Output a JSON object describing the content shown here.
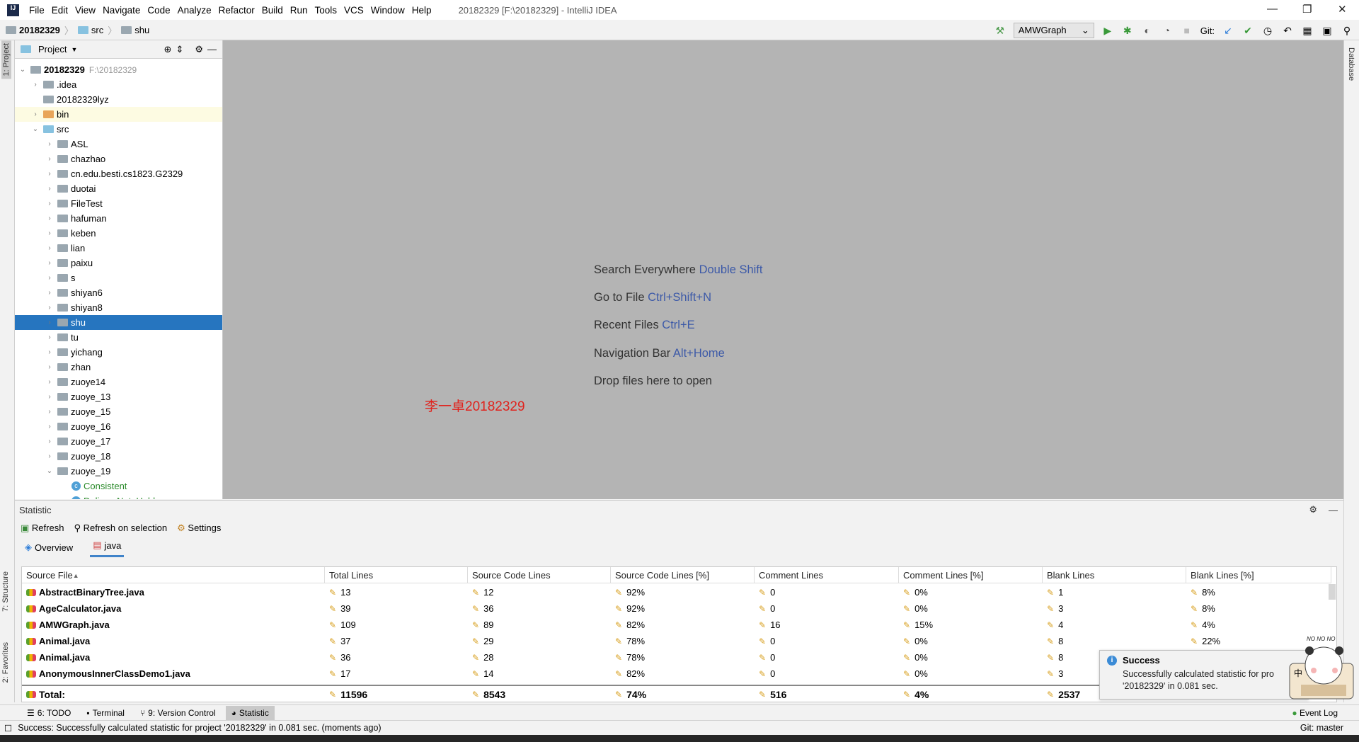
{
  "app": {
    "title": "20182329 [F:\\20182329] - IntelliJ IDEA",
    "logo": "IJ"
  },
  "menu": [
    "File",
    "Edit",
    "View",
    "Navigate",
    "Code",
    "Analyze",
    "Refactor",
    "Build",
    "Run",
    "Tools",
    "VCS",
    "Window",
    "Help"
  ],
  "breadcrumb": [
    "20182329",
    "src",
    "shu"
  ],
  "toolbar": {
    "run_config": "AMWGraph",
    "git_label": "Git:",
    "git_branch": "Git: master"
  },
  "left_stripe": {
    "project": "1: Project",
    "structure": "7: Structure",
    "favorites": "2: Favorites"
  },
  "right_stripe": {
    "database": "Database"
  },
  "project_panel": {
    "title": "Project",
    "tree": [
      {
        "level": 0,
        "name": "20182329",
        "note": "F:\\20182329",
        "type": "root",
        "arrow": "down"
      },
      {
        "level": 1,
        "name": ".idea",
        "type": "folder",
        "arrow": "right"
      },
      {
        "level": 1,
        "name": "20182329lyz",
        "type": "folder",
        "arrow": ""
      },
      {
        "level": 1,
        "name": "bin",
        "type": "folder-orange",
        "arrow": "right",
        "highlight": true
      },
      {
        "level": 1,
        "name": "src",
        "type": "folder-blue",
        "arrow": "down"
      },
      {
        "level": 2,
        "name": "ASL",
        "type": "package",
        "arrow": "right"
      },
      {
        "level": 2,
        "name": "chazhao",
        "type": "package",
        "arrow": "right"
      },
      {
        "level": 2,
        "name": "cn.edu.besti.cs1823.G2329",
        "type": "package",
        "arrow": "right"
      },
      {
        "level": 2,
        "name": "duotai",
        "type": "package",
        "arrow": "right"
      },
      {
        "level": 2,
        "name": "FileTest",
        "type": "package",
        "arrow": "right"
      },
      {
        "level": 2,
        "name": "hafuman",
        "type": "package",
        "arrow": "right"
      },
      {
        "level": 2,
        "name": "keben",
        "type": "package",
        "arrow": "right"
      },
      {
        "level": 2,
        "name": "lian",
        "type": "package",
        "arrow": "right"
      },
      {
        "level": 2,
        "name": "paixu",
        "type": "package",
        "arrow": "right"
      },
      {
        "level": 2,
        "name": "s",
        "type": "package",
        "arrow": "right"
      },
      {
        "level": 2,
        "name": "shiyan6",
        "type": "package",
        "arrow": "right"
      },
      {
        "level": 2,
        "name": "shiyan8",
        "type": "package",
        "arrow": "right"
      },
      {
        "level": 2,
        "name": "shu",
        "type": "package",
        "arrow": "right",
        "selected": true
      },
      {
        "level": 2,
        "name": "tu",
        "type": "package",
        "arrow": "right"
      },
      {
        "level": 2,
        "name": "yichang",
        "type": "package",
        "arrow": "right"
      },
      {
        "level": 2,
        "name": "zhan",
        "type": "package",
        "arrow": "right"
      },
      {
        "level": 2,
        "name": "zuoye14",
        "type": "package",
        "arrow": "right"
      },
      {
        "level": 2,
        "name": "zuoye_13",
        "type": "package",
        "arrow": "right"
      },
      {
        "level": 2,
        "name": "zuoye_15",
        "type": "package",
        "arrow": "right"
      },
      {
        "level": 2,
        "name": "zuoye_16",
        "type": "package",
        "arrow": "right"
      },
      {
        "level": 2,
        "name": "zuoye_17",
        "type": "package",
        "arrow": "right"
      },
      {
        "level": 2,
        "name": "zuoye_18",
        "type": "package",
        "arrow": "right"
      },
      {
        "level": 2,
        "name": "zuoye_19",
        "type": "package",
        "arrow": "down"
      },
      {
        "level": 3,
        "name": "Consistent",
        "type": "class",
        "arrow": ""
      },
      {
        "level": 3,
        "name": "DeliveryNoteHolder",
        "type": "class",
        "arrow": ""
      }
    ]
  },
  "editor": {
    "hints": [
      {
        "text": "Search Everywhere",
        "key": "Double Shift"
      },
      {
        "text": "Go to File",
        "key": "Ctrl+Shift+N"
      },
      {
        "text": "Recent Files",
        "key": "Ctrl+E"
      },
      {
        "text": "Navigation Bar",
        "key": "Alt+Home"
      },
      {
        "text": "Drop files here to open",
        "key": ""
      }
    ],
    "watermark": "李一卓20182329"
  },
  "statistic": {
    "title": "Statistic",
    "refresh": "Refresh",
    "refresh_selection": "Refresh on selection",
    "settings": "Settings",
    "tabs": [
      {
        "label": "Overview",
        "active": false
      },
      {
        "label": "java",
        "active": true
      }
    ],
    "columns": [
      "Source File",
      "Total Lines",
      "Source Code Lines",
      "Source Code Lines [%]",
      "Comment Lines",
      "Comment Lines [%]",
      "Blank Lines",
      "Blank Lines [%]"
    ],
    "rows": [
      [
        "AbstractBinaryTree.java",
        "13",
        "12",
        "92%",
        "0",
        "0%",
        "1",
        "8%"
      ],
      [
        "AgeCalculator.java",
        "39",
        "36",
        "92%",
        "0",
        "0%",
        "3",
        "8%"
      ],
      [
        "AMWGraph.java",
        "109",
        "89",
        "82%",
        "16",
        "15%",
        "4",
        "4%"
      ],
      [
        "Animal.java",
        "37",
        "29",
        "78%",
        "0",
        "0%",
        "8",
        "22%"
      ],
      [
        "Animal.java",
        "36",
        "28",
        "78%",
        "0",
        "0%",
        "8",
        ""
      ],
      [
        "AnonymousInnerClassDemo1.java",
        "17",
        "14",
        "82%",
        "0",
        "0%",
        "3",
        ""
      ]
    ],
    "total": [
      "Total:",
      "11596",
      "8543",
      "74%",
      "516",
      "4%",
      "2537",
      ""
    ]
  },
  "notification": {
    "title": "Success",
    "body1": "Successfully calculated statistic for pro",
    "body2": "'20182329' in 0.081 sec."
  },
  "sticker": {
    "text": "NO NO NO",
    "char": "中"
  },
  "bottom_tabs": [
    {
      "label": "6: TODO",
      "icon": "list-icon"
    },
    {
      "label": "Terminal",
      "icon": "terminal-icon"
    },
    {
      "label": "9: Version Control",
      "icon": "vcs-icon"
    },
    {
      "label": "Statistic",
      "icon": "statistic-icon",
      "active": true
    }
  ],
  "event_log": "Event Log",
  "status": "Success: Successfully calculated statistic for project '20182329' in 0.081 sec. (moments ago)"
}
